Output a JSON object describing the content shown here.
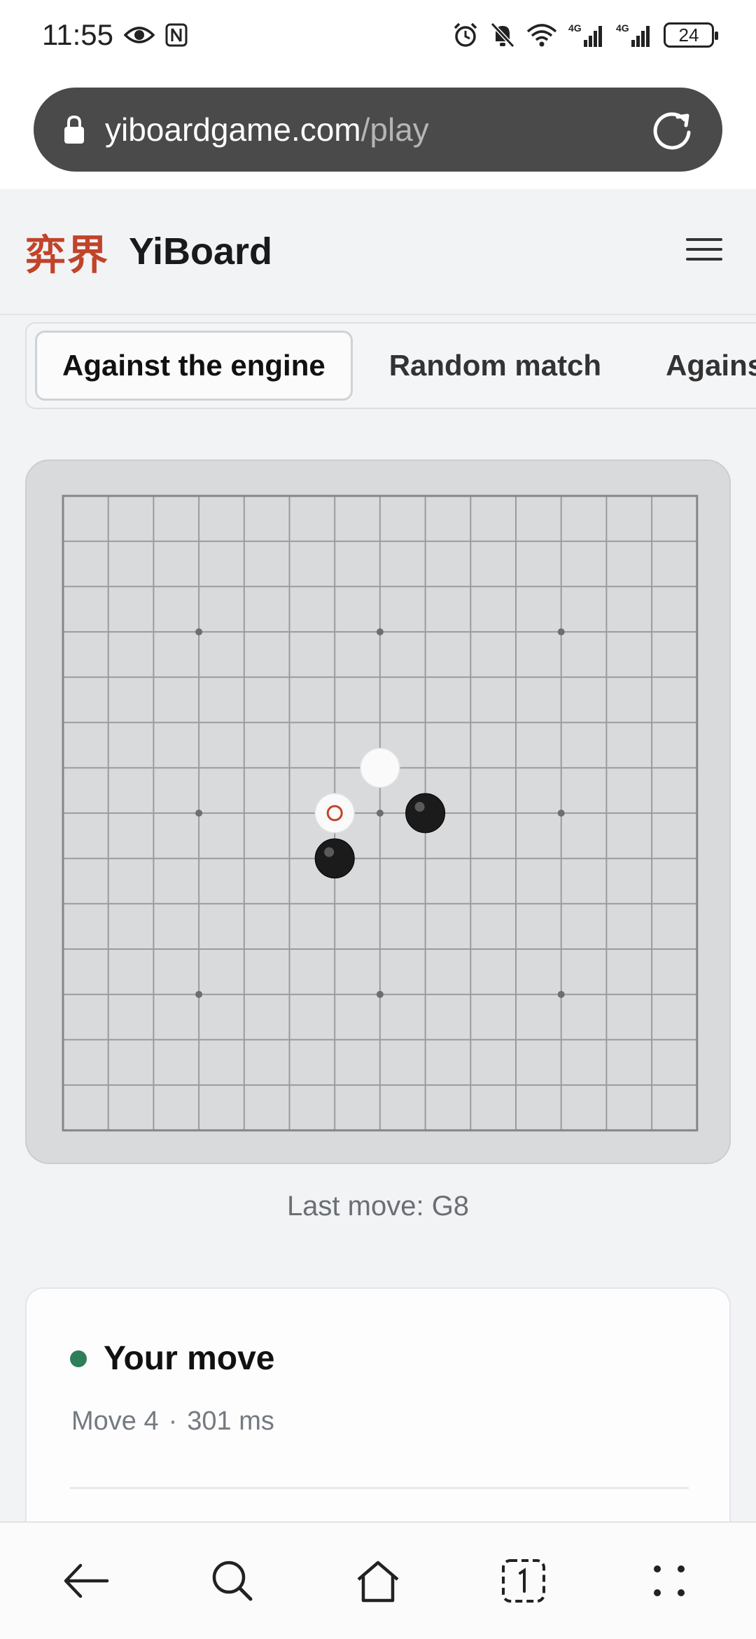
{
  "status_bar": {
    "time": "11:55",
    "battery": "24",
    "network_labels": [
      "4G",
      "4G"
    ],
    "icons": [
      "eye-icon",
      "nfc-icon",
      "alarm-icon",
      "mute-icon",
      "wifi-icon",
      "signal-icon",
      "signal-icon",
      "battery-icon"
    ]
  },
  "browser": {
    "url_domain": "yiboardgame.com",
    "url_path": "/play"
  },
  "site": {
    "logo_cjk": "弈界",
    "name": "YiBoard"
  },
  "tabs": [
    {
      "label": "Against the engine",
      "active": true
    },
    {
      "label": "Random match",
      "active": false
    },
    {
      "label": "Against a friend",
      "active": false
    }
  ],
  "board": {
    "size": 15,
    "star_points": [
      [
        3,
        3
      ],
      [
        7,
        3
      ],
      [
        11,
        3
      ],
      [
        3,
        7
      ],
      [
        11,
        7
      ],
      [
        3,
        11
      ],
      [
        7,
        11
      ],
      [
        11,
        11
      ],
      [
        7,
        7
      ]
    ],
    "stones": [
      {
        "col": 7,
        "row": 6,
        "color": "white",
        "last": false
      },
      {
        "col": 6,
        "row": 7,
        "color": "white",
        "last": true
      },
      {
        "col": 8,
        "row": 7,
        "color": "black",
        "last": false
      },
      {
        "col": 6,
        "row": 8,
        "color": "black",
        "last": false
      }
    ],
    "last_move_color": "#c0442a"
  },
  "last_move": "Last move: G8",
  "status_card": {
    "title": "Your move",
    "move_label": "Move 4",
    "separator": "·",
    "time_label": "301 ms"
  },
  "colors": {
    "accent_logo": "#c0442a",
    "turn_indicator": "#2e7d5b"
  }
}
